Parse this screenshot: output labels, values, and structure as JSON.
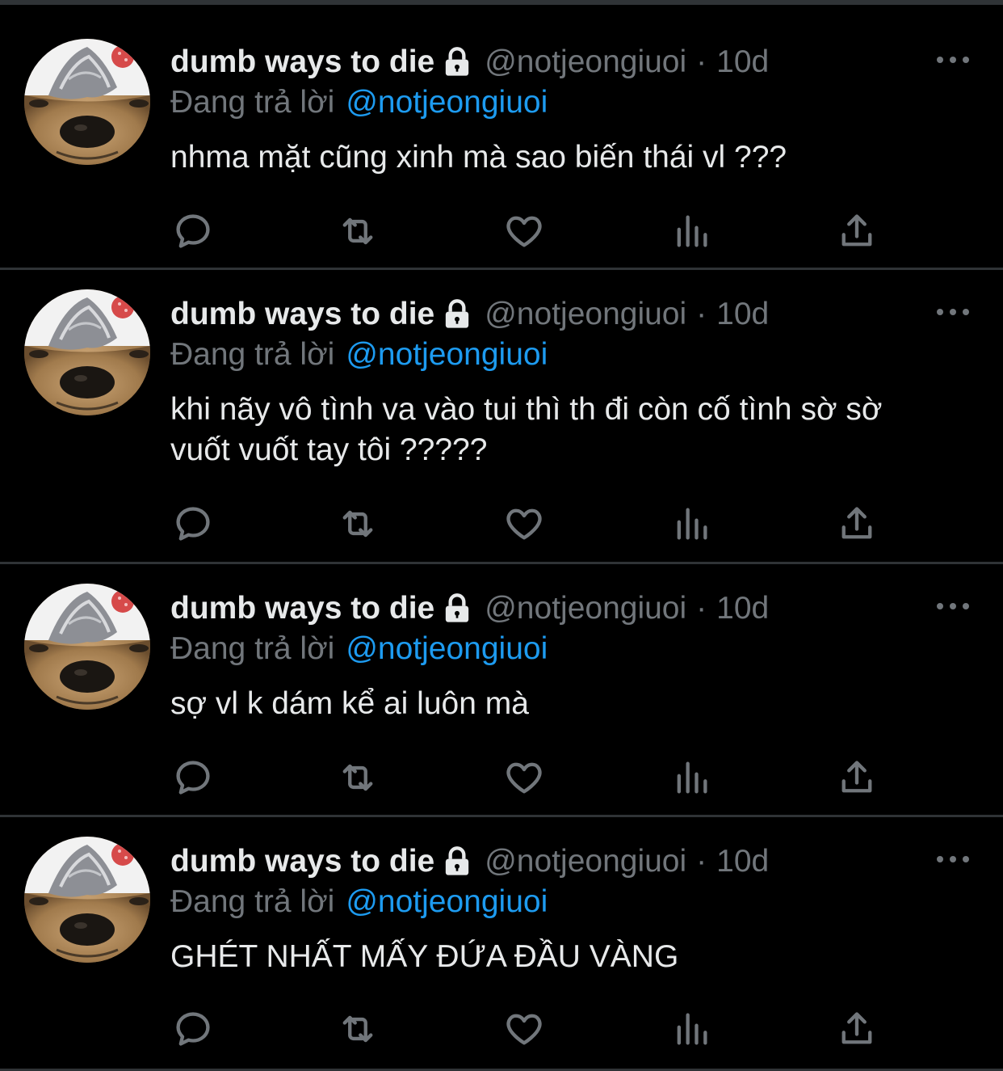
{
  "colors": {
    "background": "#000000",
    "divider": "#2f3336",
    "primary_text": "#e7e9ea",
    "secondary_text": "#71767b",
    "link": "#1d9bf0"
  },
  "icons": {
    "lock": "lock-icon",
    "more": "more-horizontal-icon",
    "reply": "reply-icon",
    "retweet": "retweet-icon",
    "like": "heart-icon",
    "views": "analytics-icon",
    "share": "share-icon"
  },
  "tweets": [
    {
      "display_name": "dumb ways to die",
      "handle": "@notjeongiuoi",
      "separator": "·",
      "time": "10d",
      "reply_prefix": "Đang trả lời",
      "reply_to": "@notjeongiuoi",
      "text": "nhma mặt cũng xinh mà sao biến thái vl ???"
    },
    {
      "display_name": "dumb ways to die",
      "handle": "@notjeongiuoi",
      "separator": "·",
      "time": "10d",
      "reply_prefix": "Đang trả lời",
      "reply_to": "@notjeongiuoi",
      "text_line1": "khi nãy vô tình va vào tui thì th đi còn cố tình sờ sờ",
      "text_line2": "vuốt vuốt tay tôi ?????"
    },
    {
      "display_name": "dumb ways to die",
      "handle": "@notjeongiuoi",
      "separator": "·",
      "time": "10d",
      "reply_prefix": "Đang trả lời",
      "reply_to": "@notjeongiuoi",
      "text": "sợ vl k dám kể ai luôn mà"
    },
    {
      "display_name": "dumb ways to die",
      "handle": "@notjeongiuoi",
      "separator": "·",
      "time": "10d",
      "reply_prefix": "Đang trả lời",
      "reply_to": "@notjeongiuoi",
      "text": "GHÉT NHẤT MẤY ĐỨA ĐẦU VÀNG"
    }
  ]
}
